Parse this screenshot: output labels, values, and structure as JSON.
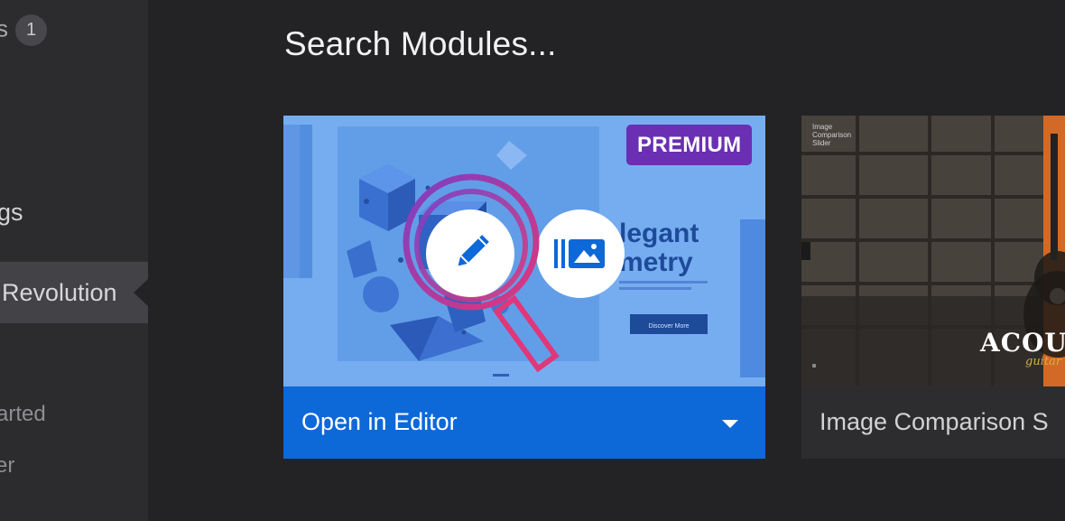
{
  "sidebar": {
    "top_item_label": "s",
    "top_item_badge": "1",
    "settings_label": "gs",
    "active_item_label": "Revolution",
    "sub_item_1": "arted",
    "sub_item_2": "er"
  },
  "main": {
    "title": "Search Modules..."
  },
  "modules": [
    {
      "badge": "PREMIUM",
      "action_label": "Open in Editor",
      "thumbnail_text_1": "legant",
      "thumbnail_text_2": "metry",
      "thumbnail_button": "Discover More"
    },
    {
      "label": "Image Comparison S",
      "thumbnail_title": "ACOUTR",
      "thumbnail_subtitle": "guitar",
      "thumbnail_small_title": "Image Comparison Slider"
    }
  ],
  "colors": {
    "background": "#232325",
    "sidebar": "#2c2c2e",
    "sidebar_active": "#434347",
    "accent_blue": "#0d68d8",
    "premium_purple": "#6a2fb3"
  },
  "icons": [
    "pencil-icon",
    "media-library-icon",
    "caret-down-icon",
    "magnifier-overlay-icon"
  ]
}
